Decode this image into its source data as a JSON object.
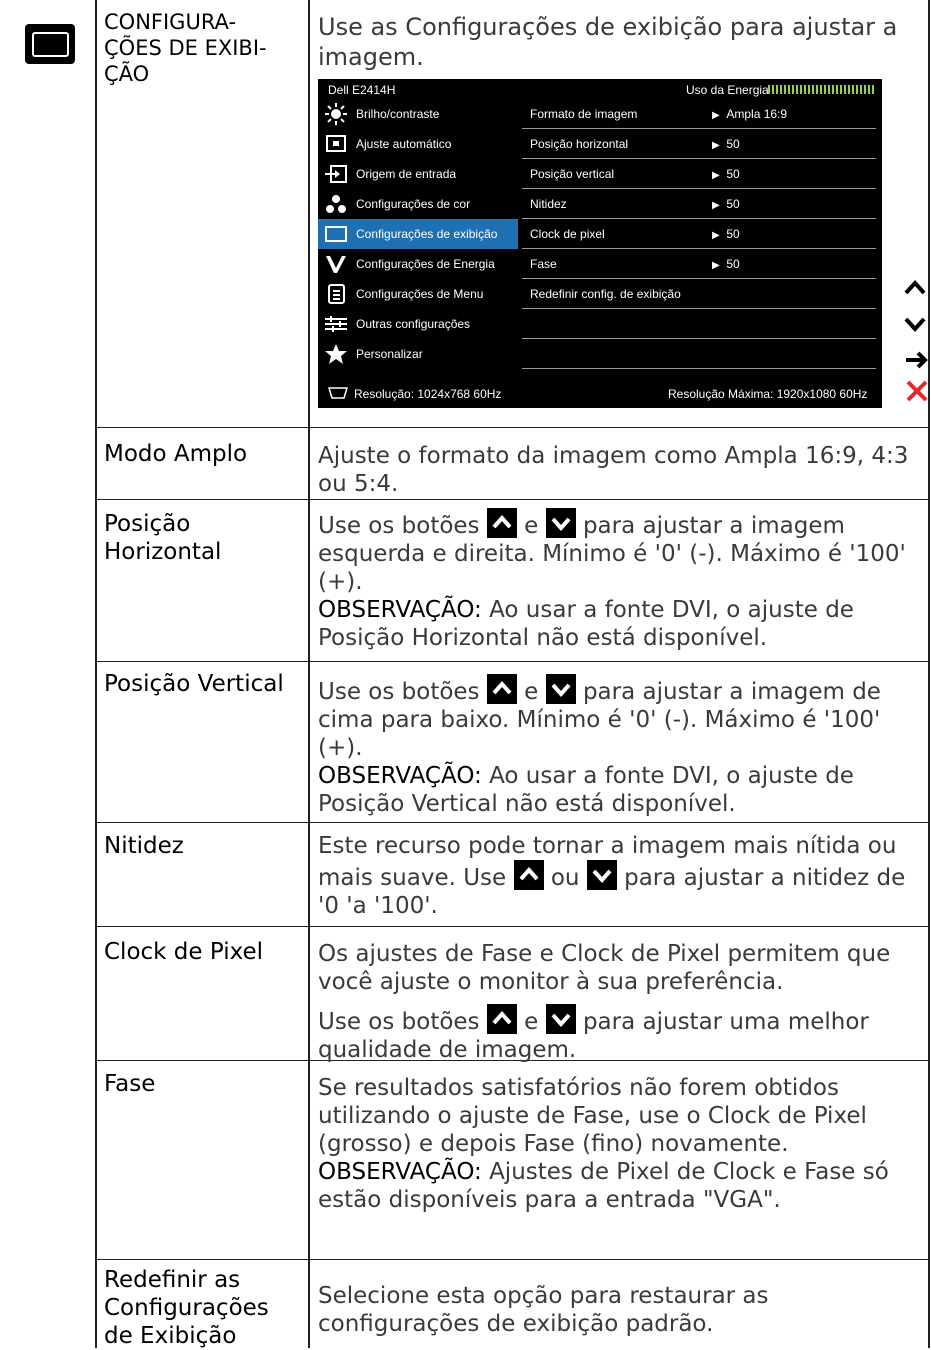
{
  "section": {
    "title": "CONFIGURA-\nÇÕES DE EXIBI-\nÇÃO",
    "intro": "Use as Configurações de exibição para ajustar a imagem."
  },
  "osd": {
    "model": "Dell E2414H",
    "energy_label": "Uso da Energia",
    "left_items": [
      {
        "label": "Brilho/contraste",
        "icon": "brightness-icon"
      },
      {
        "label": "Ajuste automático",
        "icon": "auto-adjust-icon"
      },
      {
        "label": "Origem de entrada",
        "icon": "input-source-icon"
      },
      {
        "label": "Configurações de cor",
        "icon": "color-icon"
      },
      {
        "label": "Configurações de exibição",
        "icon": "display-icon"
      },
      {
        "label": "Configurações de Energia",
        "icon": "energy-icon"
      },
      {
        "label": "Configurações de Menu",
        "icon": "menu-icon"
      },
      {
        "label": "Outras configurações",
        "icon": "other-settings-icon"
      },
      {
        "label": "Personalizar",
        "icon": "star-icon"
      }
    ],
    "selected_index": 4,
    "right_rows": [
      {
        "name": "Formato de imagem",
        "value": "Ampla 16:9"
      },
      {
        "name": "Posição horizontal",
        "value": "50"
      },
      {
        "name": "Posição vertical",
        "value": "50"
      },
      {
        "name": "Nitidez",
        "value": "50"
      },
      {
        "name": "Clock de pixel",
        "value": "50"
      },
      {
        "name": "Fase",
        "value": "50"
      },
      {
        "name": "Redefinir config. de exibição",
        "value": ""
      },
      {
        "name": "",
        "value": ""
      },
      {
        "name": "",
        "value": ""
      }
    ],
    "resolution": "Resolução: 1024x768 60Hz",
    "max_resolution": "Resolução Máxima: 1920x1080 60Hz",
    "selected_color": "#1f6fb3"
  },
  "side_controls": [
    "up-icon",
    "down-icon",
    "enter-icon",
    "exit-icon"
  ],
  "rows": {
    "modo_amplo": {
      "name": "Modo Amplo",
      "desc": "Ajuste o formato da imagem como Ampla 16:9, 4:3 ou 5:4."
    },
    "pos_h": {
      "name": "Posição Horizontal",
      "pre": "Use os botões",
      "mid": "e",
      "post": "para ajustar a imagem esquerda e direita. Mínimo é '0' (-). Máximo é '100' (+).",
      "obs_label": "OBSERVAÇÃO:",
      "obs": "Ao usar a fonte DVI, o ajuste de Posição Horizontal não está disponível."
    },
    "pos_v": {
      "name": "Posição Vertical",
      "pre": "Use os botões",
      "mid": "e",
      "post": "para ajustar a imagem de cima para baixo. Mínimo é '0' (-). Máximo é '100' (+).",
      "obs_label": "OBSERVAÇÃO:",
      "obs": "Ao usar a fonte DVI, o ajuste de Posição Vertical não está disponível."
    },
    "nitidez": {
      "name": "Nitidez",
      "line1": "Este recurso pode tornar a imagem mais nítida ou",
      "pre": "mais suave. Use",
      "mid": "ou",
      "post": "para ajustar a nitidez de '0 'a '100'."
    },
    "clock": {
      "name": "Clock de Pixel",
      "p1": "Os ajustes de Fase e Clock de Pixel permitem que você ajuste o monitor à sua preferência.",
      "pre": "Use os botões",
      "mid": "e",
      "post": "para ajustar uma melhor qualidade de imagem."
    },
    "fase": {
      "name": "Fase",
      "p1": "Se resultados satisfatórios não forem obtidos utilizando o ajuste de Fase, use o Clock de Pixel (grosso) e depois Fase (fino) novamente.",
      "obs_label": "OBSERVAÇÃO:",
      "obs": "Ajustes de Pixel de Clock e Fase só estão disponíveis para a entrada \"VGA\"."
    },
    "redefinir": {
      "name": "Redefinir as Configurações de Exibição",
      "desc": "Selecione esta opção para restaurar as configurações de exibição padrão."
    }
  }
}
